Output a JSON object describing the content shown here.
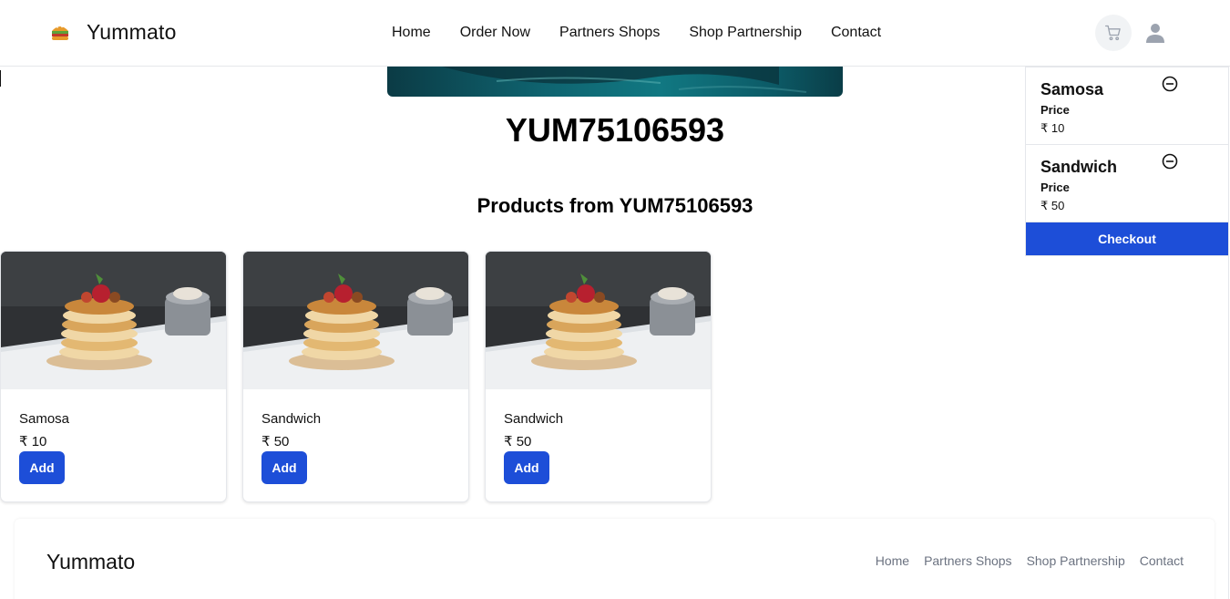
{
  "header": {
    "brand": "Yummato",
    "nav": [
      "Home",
      "Order Now",
      "Partners Shops",
      "Shop Partnership",
      "Contact"
    ]
  },
  "shop": {
    "id_title": "YUM75106593",
    "products_title": "Products from YUM75106593"
  },
  "products": [
    {
      "name": "Samosa",
      "price": "₹ 10",
      "button": "Add"
    },
    {
      "name": "Sandwich",
      "price": "₹ 50",
      "button": "Add"
    },
    {
      "name": "Sandwich",
      "price": "₹ 50",
      "button": "Add"
    }
  ],
  "cart": {
    "items": [
      {
        "name": "Samosa",
        "price_label": "Price",
        "price": "₹ 10"
      },
      {
        "name": "Sandwich",
        "price_label": "Price",
        "price": "₹ 50"
      }
    ],
    "checkout": "Checkout"
  },
  "footer": {
    "brand": "Yummato",
    "nav": [
      "Home",
      "Partners Shops",
      "Shop Partnership",
      "Contact"
    ]
  },
  "colors": {
    "accent": "#1d4ed8",
    "cart_bg": "#f1f3f5",
    "icon_gray": "#9ca3af"
  },
  "icons": [
    "burger-icon",
    "cart-icon",
    "user-icon",
    "minus-circle-icon"
  ]
}
